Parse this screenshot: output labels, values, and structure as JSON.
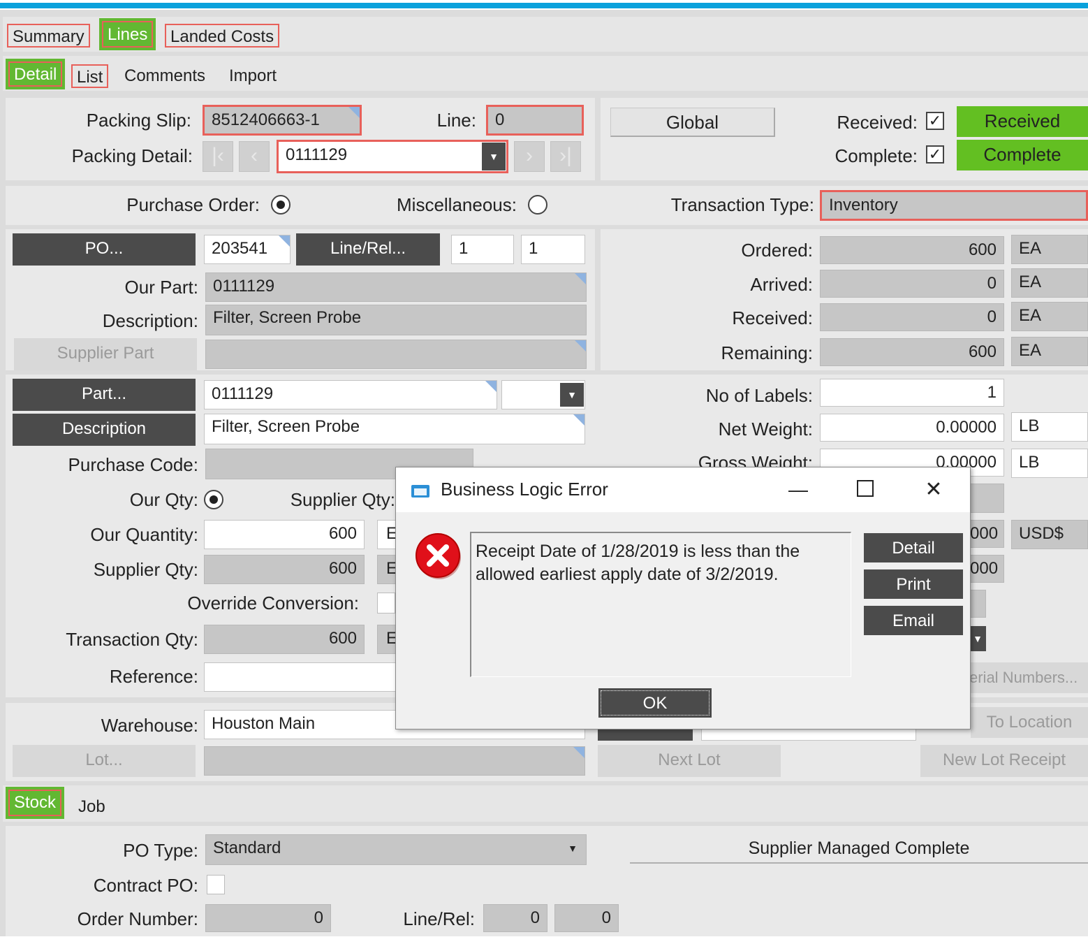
{
  "tabs_top": [
    "Summary",
    "Lines",
    "Landed Costs"
  ],
  "tabs_sub": [
    "Detail",
    "List",
    "Comments",
    "Import"
  ],
  "header": {
    "packing_slip_label": "Packing Slip:",
    "packing_slip": "8512406663-1",
    "line_label": "Line:",
    "line": "0",
    "packing_detail_label": "Packing Detail:",
    "packing_detail": "0111129",
    "global_button": "Global",
    "received_label": "Received:",
    "received_button": "Received",
    "complete_label": "Complete:",
    "complete_button": "Complete",
    "check_mark": "✓"
  },
  "ordertype": {
    "purchase_order_label": "Purchase Order:",
    "miscellaneous_label": "Miscellaneous:",
    "transaction_type_label": "Transaction Type:",
    "transaction_type": "Inventory"
  },
  "po": {
    "po_button": "PO...",
    "po_number": "203541",
    "linerel_button": "Line/Rel...",
    "line": "1",
    "rel": "1",
    "our_part_label": "Our Part:",
    "our_part": "0111129",
    "description_label": "Description:",
    "description": "Filter, Screen Probe",
    "supplier_part_button": "Supplier Part",
    "supplier_part": ""
  },
  "quantities": [
    {
      "label": "Ordered:",
      "value": "600",
      "uom": "EA"
    },
    {
      "label": "Arrived:",
      "value": "0",
      "uom": "EA"
    },
    {
      "label": "Received:",
      "value": "0",
      "uom": "EA"
    },
    {
      "label": "Remaining:",
      "value": "600",
      "uom": "EA"
    }
  ],
  "part": {
    "part_button": "Part...",
    "part": "0111129",
    "description_button": "Description",
    "description": "Filter, Screen Probe",
    "purchase_code_label": "Purchase Code:",
    "our_qty_label": "Our Qty:",
    "supplier_qty_radio_label": "Supplier Qty:",
    "our_quantity_label": "Our Quantity:",
    "our_quantity": "600",
    "supplier_qty_label": "Supplier Qty:",
    "supplier_qty": "600",
    "override_label": "Override Conversion:",
    "transaction_qty_label": "Transaction Qty:",
    "transaction_qty": "600",
    "reference_label": "Reference:",
    "uom_partial": "E"
  },
  "labels": {
    "no_of_labels_label": "No of Labels:",
    "no_of_labels": "1",
    "net_weight_label": "Net Weight:",
    "net_weight": "0.00000",
    "net_uom": "LB",
    "gross_weight_label": "Gross Weight:",
    "gross_weight": "0.00000",
    "gross_uom": "LB",
    "cost1_partial": "000",
    "cost2_partial": "000",
    "currency": "USD$",
    "serial_partial": "erial Numbers..."
  },
  "warehouse": {
    "warehouse_label": "Warehouse:",
    "warehouse": "Houston Main",
    "lot_button": "Lot...",
    "next_lot": "Next Lot",
    "to_location": "To Location",
    "new_lot_receipt": "New Lot Receipt"
  },
  "tabs_bottom": [
    "Stock",
    "Job"
  ],
  "bottom": {
    "po_type_label": "PO Type:",
    "po_type": "Standard",
    "supplier_managed": "Supplier Managed Complete",
    "contract_po_label": "Contract PO:",
    "order_number_label": "Order Number:",
    "order_number": "0",
    "linerel_label": "Line/Rel:",
    "line": "0",
    "rel": "0"
  },
  "dialog": {
    "title": "Business Logic Error",
    "message": "Receipt Date of 1/28/2019 is less than the allowed earliest apply date of 3/2/2019.",
    "detail_button": "Detail",
    "print_button": "Print",
    "email_button": "Email",
    "ok_button": "OK",
    "minimize": "—",
    "close": "✕"
  },
  "colors": {
    "accent_green": "#62b832",
    "highlight_red": "#e8605a",
    "title_blue": "#0aa1dc"
  }
}
